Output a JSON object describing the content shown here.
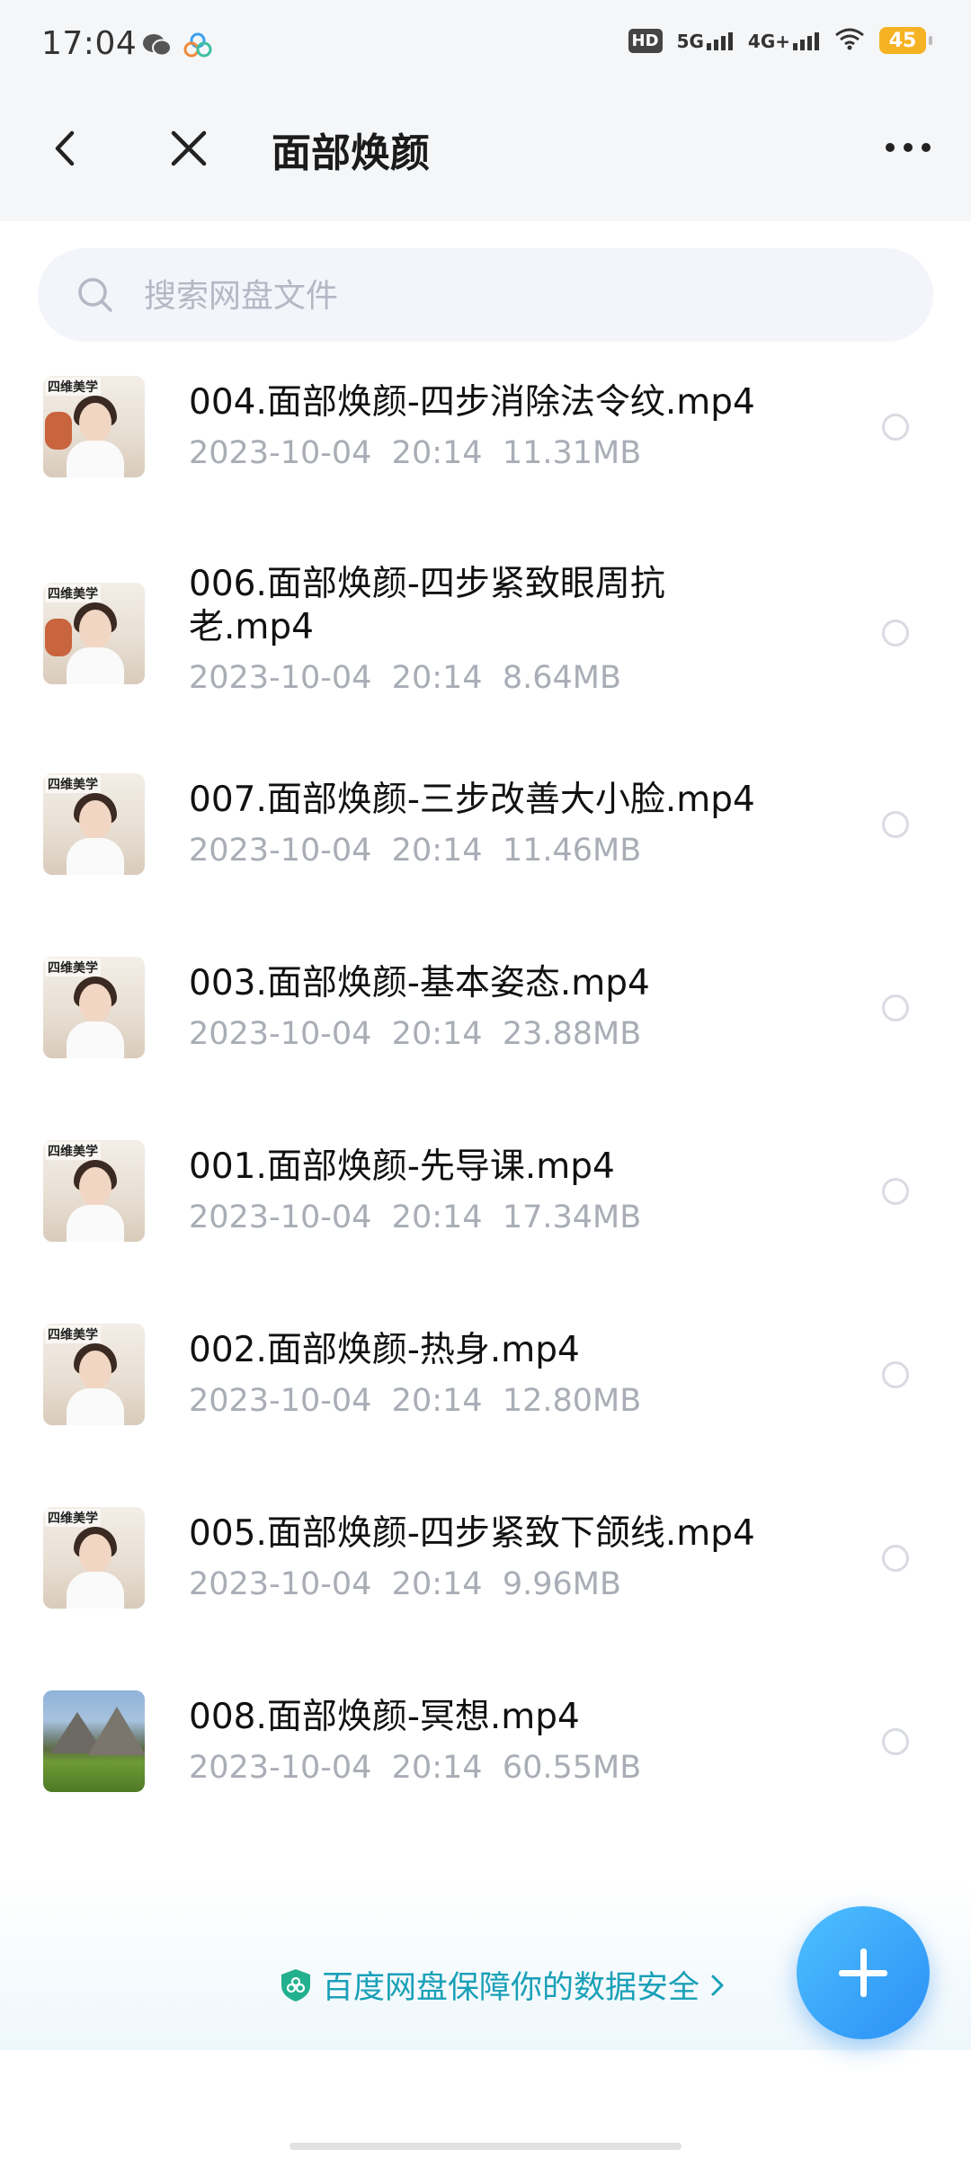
{
  "status_bar": {
    "time": "17:04",
    "hd_label": "HD",
    "net1": "5G",
    "net2": "4G+",
    "battery": "45"
  },
  "header": {
    "title": "面部焕颜"
  },
  "search": {
    "placeholder": "搜索网盘文件"
  },
  "files": [
    {
      "name": "004.面部焕颜-四步消除法令纹.mp4",
      "date": "2023-10-04",
      "time": "20:14",
      "size": "11.31MB",
      "thumb": "person"
    },
    {
      "name": "006.面部焕颜-四步紧致眼周抗老.mp4",
      "date": "2023-10-04",
      "time": "20:14",
      "size": "8.64MB",
      "thumb": "person"
    },
    {
      "name": "007.面部焕颜-三步改善大小脸.mp4",
      "date": "2023-10-04",
      "time": "20:14",
      "size": "11.46MB",
      "thumb": "person"
    },
    {
      "name": "003.面部焕颜-基本姿态.mp4",
      "date": "2023-10-04",
      "time": "20:14",
      "size": "23.88MB",
      "thumb": "person"
    },
    {
      "name": "001.面部焕颜-先导课.mp4",
      "date": "2023-10-04",
      "time": "20:14",
      "size": "17.34MB",
      "thumb": "person"
    },
    {
      "name": "002.面部焕颜-热身.mp4",
      "date": "2023-10-04",
      "time": "20:14",
      "size": "12.80MB",
      "thumb": "person"
    },
    {
      "name": "005.面部焕颜-四步紧致下颌线.mp4",
      "date": "2023-10-04",
      "time": "20:14",
      "size": "9.96MB",
      "thumb": "person"
    },
    {
      "name": "008.面部焕颜-冥想.mp4",
      "date": "2023-10-04",
      "time": "20:14",
      "size": "60.55MB",
      "thumb": "landscape"
    }
  ],
  "thumb_tag": "四维美学",
  "footer": {
    "security_text": "百度网盘保障你的数据安全"
  },
  "colors": {
    "accent": "#2a8ff5",
    "link": "#1aa0b8",
    "meta_text": "#a9adb6"
  }
}
